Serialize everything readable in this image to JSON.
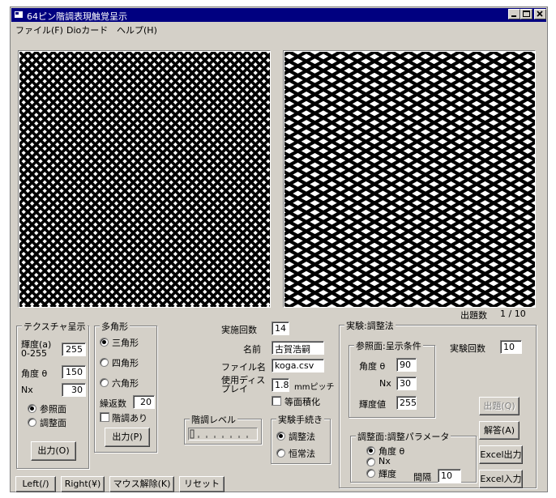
{
  "window": {
    "title": "64ピン階調表現触覚呈示"
  },
  "menu": {
    "file": "ファイル(F)",
    "dio": "Dioカード",
    "help": "ヘルプ(H)"
  },
  "question_count": {
    "label": "出題数",
    "value": "1 / 10"
  },
  "texture": {
    "legend": "テクスチャ呈示",
    "brightness_label": "輝度(a) 0-255",
    "brightness_value": "255",
    "angle_label": "角度 θ",
    "angle_value": "150",
    "nx_label": "Nx",
    "nx_value": "30",
    "ref_radio": "参照面",
    "adj_radio": "調整面",
    "output_button": "出力(O)"
  },
  "polygon": {
    "legend": "多角形",
    "triangle": "三角形",
    "square": "四角形",
    "hexagon": "六角形",
    "repeat_label": "繰返数",
    "repeat_value": "20",
    "gradation_check": "階調あり",
    "output_button": "出力(P)"
  },
  "session": {
    "count_label": "実施回数",
    "count_value": "14",
    "name_label": "名前",
    "name_value": "古賀浩嗣",
    "file_label": "ファイル名",
    "file_value": "koga.csv",
    "display_label": "使用ディス プレイ",
    "display_value": "1.8",
    "display_unit": "mmピッチ",
    "equal_area_check": "等面積化"
  },
  "gradation_level": {
    "legend": "階調レベル"
  },
  "procedure": {
    "legend": "実験手続き",
    "adjust": "調整法",
    "constant": "恒常法"
  },
  "experiment": {
    "legend": "実験:調整法",
    "ref_legend": "参照面:呈示条件",
    "angle_label": "角度 θ",
    "angle_value": "90",
    "nx_label": "Nx",
    "nx_value": "30",
    "brightness_label": "輝度値",
    "brightness_value": "255",
    "runs_label": "実験回数",
    "runs_value": "10",
    "adj_legend": "調整面:調整パラメータ",
    "param_angle": "角度 θ",
    "param_nx": "Nx",
    "param_brightness": "輝度",
    "interval_label": "間隔",
    "interval_value": "10",
    "question_button": "出題(Q)",
    "answer_button": "解答(A)",
    "excel_out_button": "Excel出力",
    "excel_in_button": "Excel入力"
  },
  "bottom": {
    "left": "Left(/)",
    "right": "Right(¥)",
    "mouse": "マウス解除(K)",
    "reset": "リセット"
  },
  "patterns": {
    "left": {
      "spacing": 10.4,
      "stroke": 3.6
    },
    "right": {
      "spacing": 21,
      "stroke": 4.2
    }
  },
  "colors": {
    "title_bar": "#000080",
    "face": "#d4d0c8"
  }
}
